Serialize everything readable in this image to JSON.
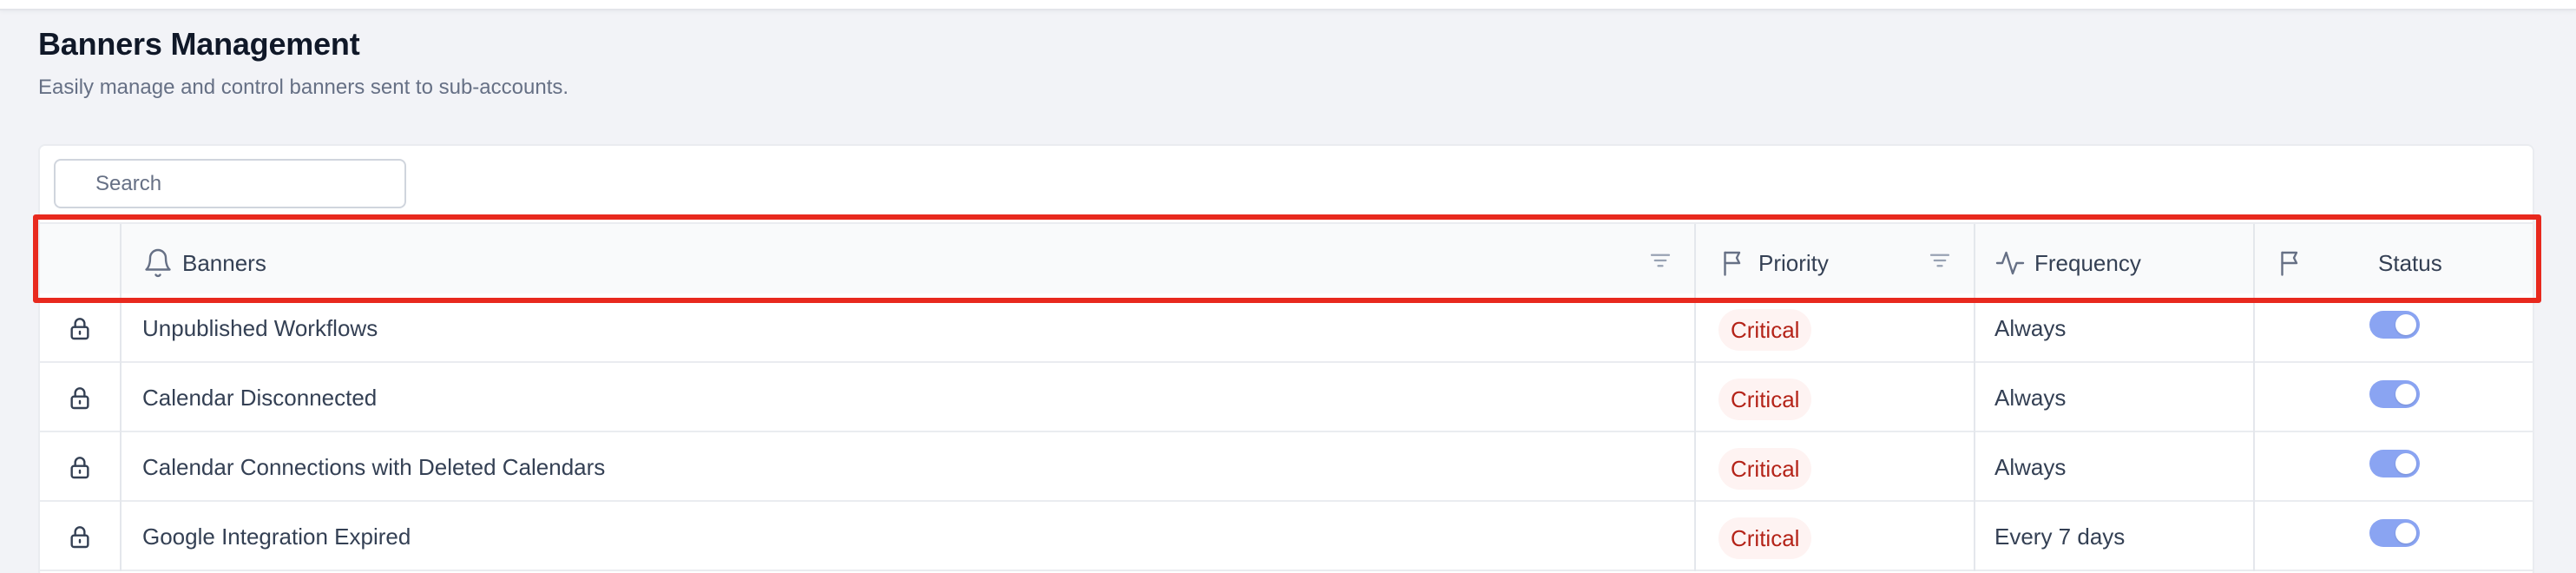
{
  "page": {
    "title": "Banners Management",
    "subtitle": "Easily manage and control banners sent to sub-accounts."
  },
  "search": {
    "placeholder": "Search"
  },
  "table": {
    "columns": {
      "banners": "Banners",
      "priority": "Priority",
      "frequency": "Frequency",
      "status": "Status"
    },
    "rows": [
      {
        "name": "Unpublished Workflows",
        "priority": "Critical",
        "frequency": "Always",
        "enabled": true,
        "locked": true
      },
      {
        "name": "Calendar Disconnected",
        "priority": "Critical",
        "frequency": "Always",
        "enabled": true,
        "locked": true
      },
      {
        "name": "Calendar Connections with Deleted Calendars",
        "priority": "Critical",
        "frequency": "Always",
        "enabled": true,
        "locked": true
      },
      {
        "name": "Google Integration Expired",
        "priority": "Critical",
        "frequency": "Every 7 days",
        "enabled": true,
        "locked": true
      }
    ]
  },
  "icons": {
    "banners_column": "bell-icon",
    "priority_column": "flag-icon",
    "frequency_column": "activity-icon",
    "status_column": "flag-icon",
    "filter": "filter-lines-icon",
    "row_lock": "lock-icon"
  },
  "colors": {
    "critical_text": "#b42318",
    "critical_bg": "#fef3f2",
    "toggle_on": "#8aa4f2",
    "highlight": "#e8291e"
  }
}
